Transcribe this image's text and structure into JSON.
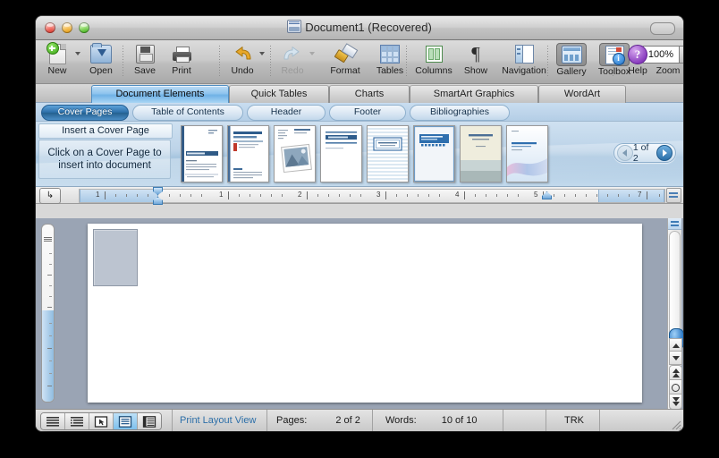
{
  "window": {
    "title": "Document1 (Recovered)",
    "doc_icon": "word-document-icon",
    "close_button": "close",
    "minimize_button": "minimize",
    "zoom_button": "zoom",
    "toolbar_toggle": "toolbar-toggle"
  },
  "toolbar": {
    "items": [
      {
        "label": "New",
        "icon": "new-document-icon",
        "dim": false,
        "caret": true
      },
      {
        "label": "Open",
        "icon": "open-folder-icon",
        "dim": false,
        "caret": false
      },
      {
        "label": "Save",
        "icon": "save-disk-icon",
        "dim": false,
        "caret": false
      },
      {
        "label": "Print",
        "icon": "printer-icon",
        "dim": false,
        "caret": false
      },
      {
        "label": "Undo",
        "icon": "undo-arrow-icon",
        "dim": false,
        "caret": true
      },
      {
        "label": "Redo",
        "icon": "redo-arrow-icon",
        "dim": true,
        "caret": true
      },
      {
        "label": "Format",
        "icon": "format-brush-icon",
        "dim": false,
        "caret": false
      },
      {
        "label": "Tables",
        "icon": "table-grid-icon",
        "dim": false,
        "caret": false
      },
      {
        "label": "Columns",
        "icon": "columns-icon",
        "dim": false,
        "caret": false
      },
      {
        "label": "Show",
        "icon": "pilcrow-icon",
        "dim": false,
        "caret": false
      },
      {
        "label": "Navigation",
        "icon": "navigation-pane-icon",
        "dim": false,
        "caret": false
      },
      {
        "label": "Gallery",
        "icon": "gallery-icon",
        "dim": false,
        "caret": false
      },
      {
        "label": "Toolbox",
        "icon": "toolbox-icon",
        "dim": false,
        "caret": false
      },
      {
        "label": "Zoom",
        "icon": "zoom-field",
        "dim": false,
        "caret": false
      },
      {
        "label": "Help",
        "icon": "help-icon",
        "dim": false,
        "caret": false
      }
    ],
    "zoom_value": "100%"
  },
  "ribbon": {
    "tabs": [
      {
        "label": "Document Elements",
        "active": true
      },
      {
        "label": "Quick Tables",
        "active": false
      },
      {
        "label": "Charts",
        "active": false
      },
      {
        "label": "SmartArt Graphics",
        "active": false
      },
      {
        "label": "WordArt",
        "active": false
      }
    ],
    "subtabs": [
      {
        "label": "Cover Pages",
        "active": true
      },
      {
        "label": "Table of Contents",
        "active": false
      },
      {
        "label": "Header",
        "active": false
      },
      {
        "label": "Footer",
        "active": false
      },
      {
        "label": "Bibliographies",
        "active": false
      }
    ],
    "insert_header": "Insert a Cover Page",
    "insert_body": "Click on a Cover Page to insert into document",
    "pager_label": "1 of 2",
    "prev_button": "previous-page",
    "next_button": "next-page",
    "thumbnails": [
      {
        "name": "cover-page-thumb-1",
        "style": "annual-report"
      },
      {
        "name": "cover-page-thumb-2",
        "style": "title-left-rule"
      },
      {
        "name": "cover-page-thumb-3",
        "style": "photo-frame"
      },
      {
        "name": "cover-page-thumb-4",
        "style": "banner-bars"
      },
      {
        "name": "cover-page-thumb-5",
        "style": "pinstripe"
      },
      {
        "name": "cover-page-thumb-6",
        "style": "blue-block"
      },
      {
        "name": "cover-page-thumb-7",
        "style": "cream-centered"
      },
      {
        "name": "cover-page-thumb-8",
        "style": "gradient-wave"
      }
    ]
  },
  "ruler": {
    "tab_selector": "tab-stop-selector",
    "marks": [
      "1",
      "1",
      "2",
      "3",
      "4",
      "5",
      "7"
    ],
    "unit": "inches"
  },
  "status": {
    "view_buttons": [
      {
        "name": "draft-view-button",
        "active": false
      },
      {
        "name": "outline-view-button",
        "active": false
      },
      {
        "name": "publishing-layout-button",
        "active": false
      },
      {
        "name": "print-layout-button",
        "active": true
      },
      {
        "name": "notebook-layout-button",
        "active": false
      }
    ],
    "view_label": "Print Layout View",
    "pages_label": "Pages:",
    "pages_value": "2 of 2",
    "words_label": "Words:",
    "words_value": "10 of 10",
    "spelling_icon": "spelling-check-icon",
    "track_changes_label": "TRK",
    "track_changes_icon": "track-changes-icon"
  },
  "colors": {
    "accent_blue": "#2a6fa8",
    "ribbon_blue": "#bed5ea",
    "active_tab": "#6fb2e6",
    "status_text_blue": "#2d6fa8",
    "desktop": "#000000"
  }
}
